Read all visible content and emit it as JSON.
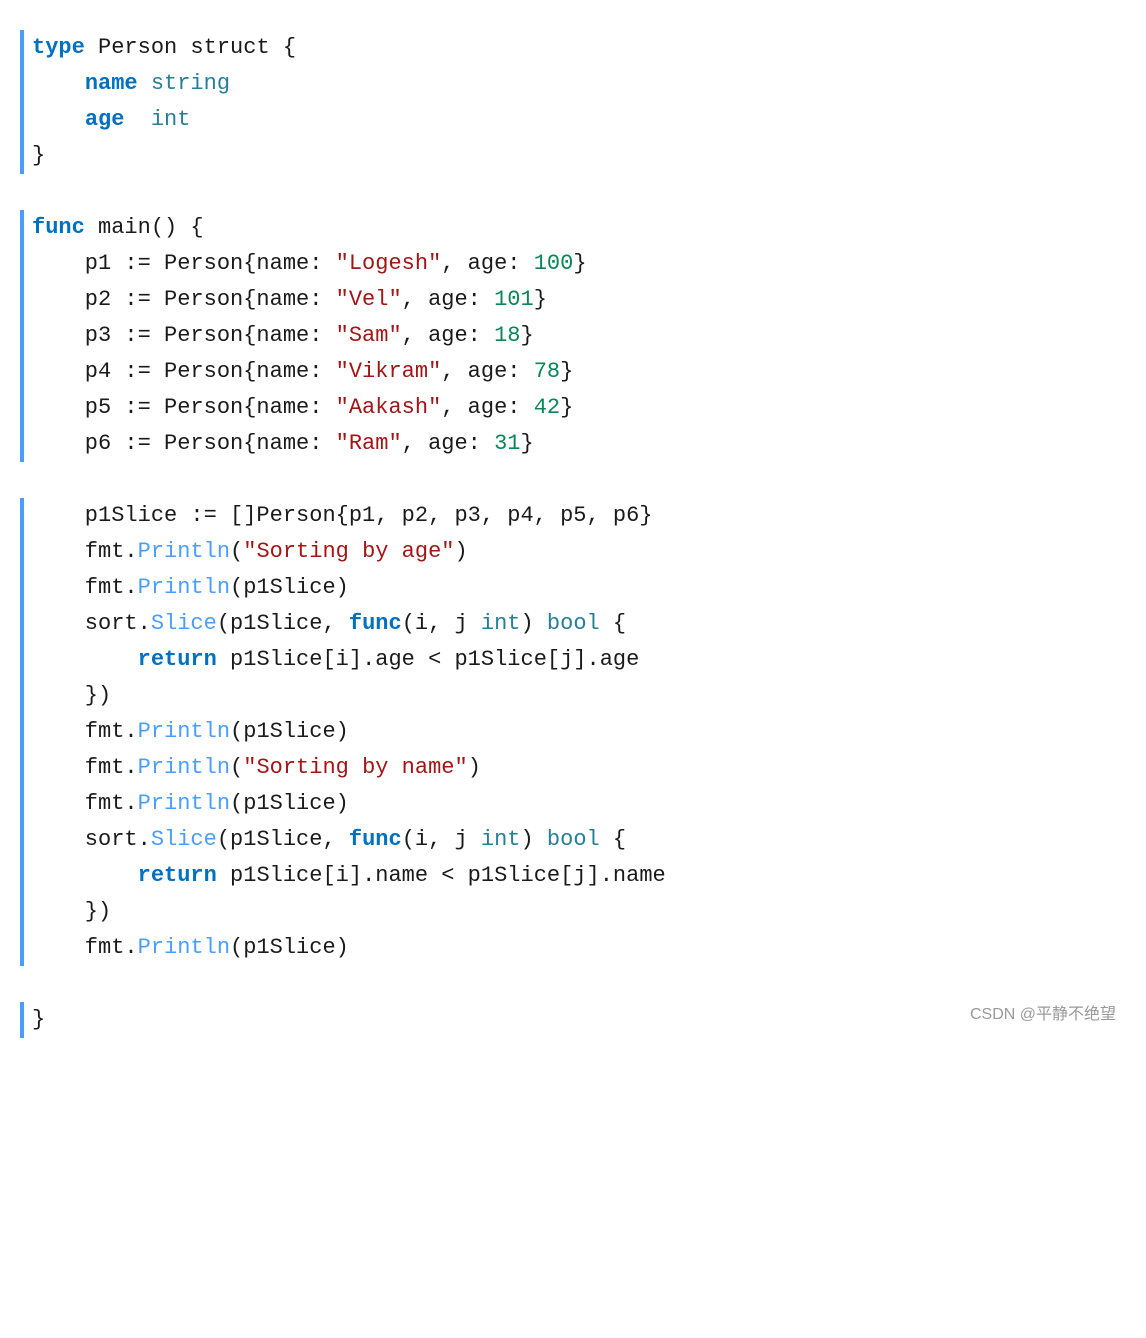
{
  "watermark": "CSDN @平静不绝望",
  "code": {
    "lines": [
      {
        "type": "struct_def",
        "text": "type Person struct {"
      },
      {
        "type": "field",
        "text": "    name string"
      },
      {
        "type": "field",
        "text": "    age  int"
      },
      {
        "type": "close",
        "text": "}"
      },
      {
        "type": "empty"
      },
      {
        "type": "func_def",
        "text": "func main() {"
      },
      {
        "type": "assign",
        "text": "    p1 := Person{name: \"Logesh\", age: 100}"
      },
      {
        "type": "assign",
        "text": "    p2 := Person{name: \"Vel\", age: 101}"
      },
      {
        "type": "assign",
        "text": "    p3 := Person{name: \"Sam\", age: 18}"
      },
      {
        "type": "assign",
        "text": "    p4 := Person{name: \"Vikram\", age: 78}"
      },
      {
        "type": "assign",
        "text": "    p5 := Person{name: \"Aakash\", age: 42}"
      },
      {
        "type": "assign",
        "text": "    p6 := Person{name: \"Ram\", age: 31}"
      },
      {
        "type": "empty"
      },
      {
        "type": "slice",
        "text": "    p1Slice := []Person{p1, p2, p3, p4, p5, p6}"
      },
      {
        "type": "println",
        "text": "    fmt.Println(\"Sorting by age\")"
      },
      {
        "type": "println2",
        "text": "    fmt.Println(p1Slice)"
      },
      {
        "type": "sort_start",
        "text": "    sort.Slice(p1Slice, func(i, j int) bool {"
      },
      {
        "type": "return_age",
        "text": "        return p1Slice[i].age < p1Slice[j].age"
      },
      {
        "type": "close_sort",
        "text": "    })"
      },
      {
        "type": "println2",
        "text": "    fmt.Println(p1Slice)"
      },
      {
        "type": "println",
        "text": "    fmt.Println(\"Sorting by name\")"
      },
      {
        "type": "println2",
        "text": "    fmt.Println(p1Slice)"
      },
      {
        "type": "sort_start2",
        "text": "    sort.Slice(p1Slice, func(i, j int) bool {"
      },
      {
        "type": "return_name",
        "text": "        return p1Slice[i].name < p1Slice[j].name"
      },
      {
        "type": "close_sort",
        "text": "    })"
      },
      {
        "type": "println2",
        "text": "    fmt.Println(p1Slice)"
      },
      {
        "type": "empty"
      },
      {
        "type": "close",
        "text": "}"
      }
    ]
  }
}
